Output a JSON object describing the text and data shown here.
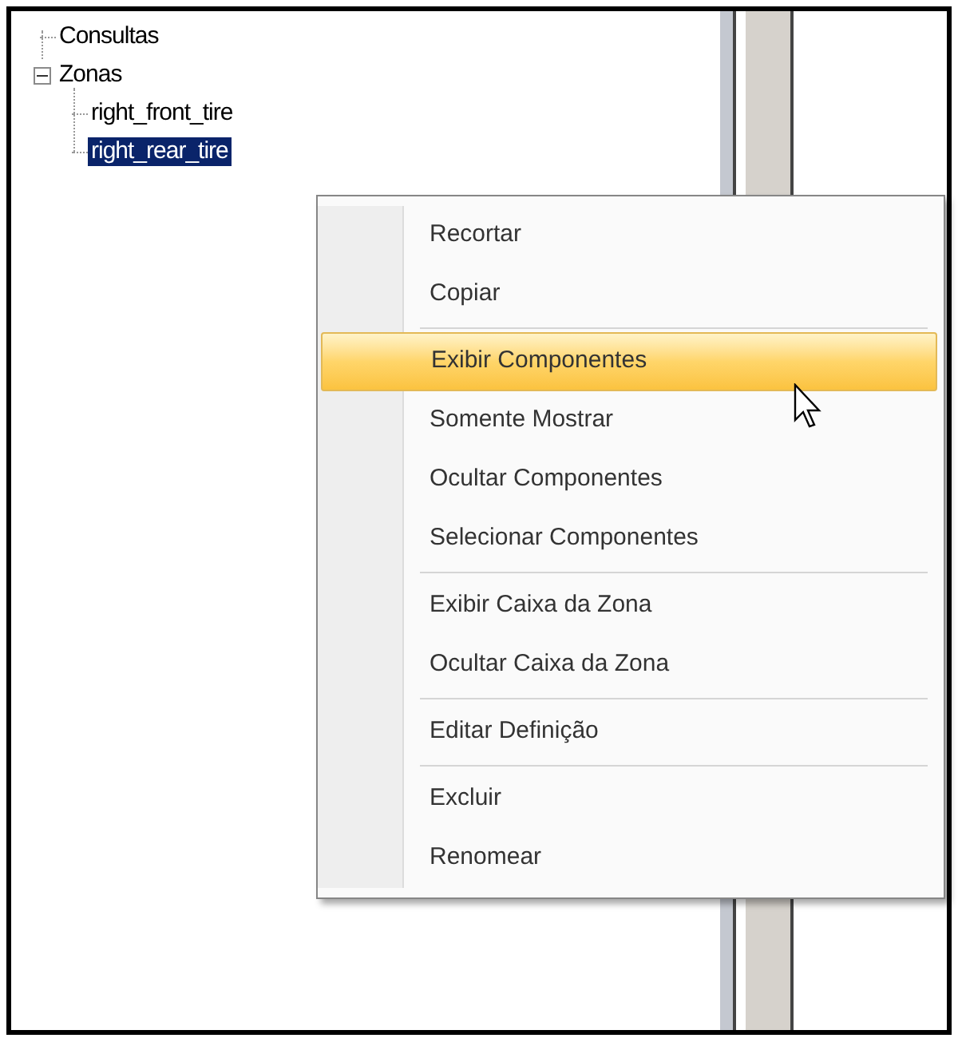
{
  "tree": [
    {
      "label": "Consultas",
      "selected": false
    },
    {
      "label": "Zonas",
      "selected": false,
      "expanded": true,
      "children": [
        {
          "label": "right_front_tire",
          "selected": false
        },
        {
          "label": "right_rear_tire",
          "selected": true
        }
      ]
    }
  ],
  "context_menu": [
    {
      "label": "Recortar",
      "selected": false,
      "separator_after": false
    },
    {
      "label": "Copiar",
      "selected": false,
      "separator_after": true
    },
    {
      "label": "Exibir Componentes",
      "selected": true,
      "separator_after": false
    },
    {
      "label": "Somente Mostrar",
      "selected": false,
      "separator_after": false
    },
    {
      "label": "Ocultar Componentes",
      "selected": false,
      "separator_after": false
    },
    {
      "label": "Selecionar Componentes",
      "selected": false,
      "separator_after": true
    },
    {
      "label": "Exibir Caixa da Zona",
      "selected": false,
      "separator_after": false
    },
    {
      "label": "Ocultar Caixa da Zona",
      "selected": false,
      "separator_after": true
    },
    {
      "label": "Editar Definição",
      "selected": false,
      "separator_after": true
    },
    {
      "label": "Excluir",
      "selected": false,
      "separator_after": false
    },
    {
      "label": "Renomear",
      "selected": false,
      "separator_after": false
    }
  ]
}
